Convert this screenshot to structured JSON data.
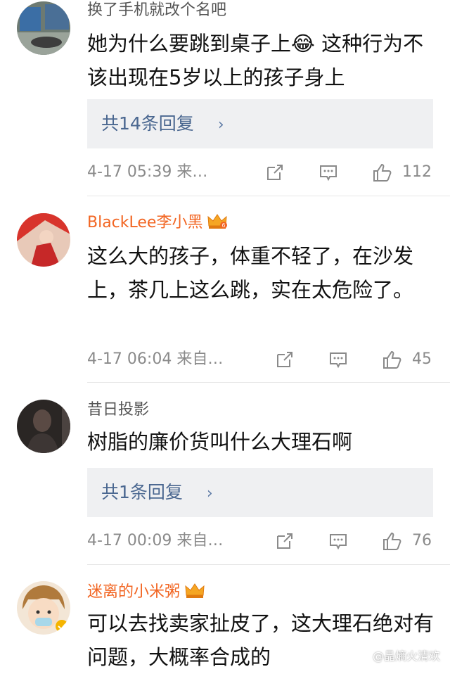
{
  "comments": [
    {
      "username": "换了手机就改个名吧",
      "text": "她为什么要跳到桌子上😂 这种行为不该出现在5岁以上的孩子身上",
      "replies_label": "共14条回复",
      "time": "4-17 05:39 来…",
      "likes": "112",
      "avatar_icon": "trash-bin-avatar"
    },
    {
      "username": "BlackLee李小黑",
      "text": "这么大的孩子，体重不轻了，在沙发上，茶几上这么跳，实在太危险了。",
      "time": "4-17 06:04 来自…",
      "likes": "45",
      "avatar_icon": "red-figure-avatar",
      "badge": "6"
    },
    {
      "username": "昔日投影",
      "text": "树脂的廉价货叫什么大理石啊",
      "replies_label": "共1条回复",
      "time": "4-17 00:09 来自…",
      "likes": "76",
      "avatar_icon": "dark-portrait-avatar"
    },
    {
      "username": "迷离的小米粥",
      "text": "可以去找卖家扯皮了，这大理石绝对有问题，大概率合成的",
      "avatar_icon": "cartoon-child-avatar"
    }
  ],
  "watermark": "@晶熵火清欢",
  "colors": {
    "vip_name": "#f26522",
    "reply_link": "#4a6790",
    "reply_bg": "#eff0f2",
    "meta": "#8a8a8a"
  }
}
